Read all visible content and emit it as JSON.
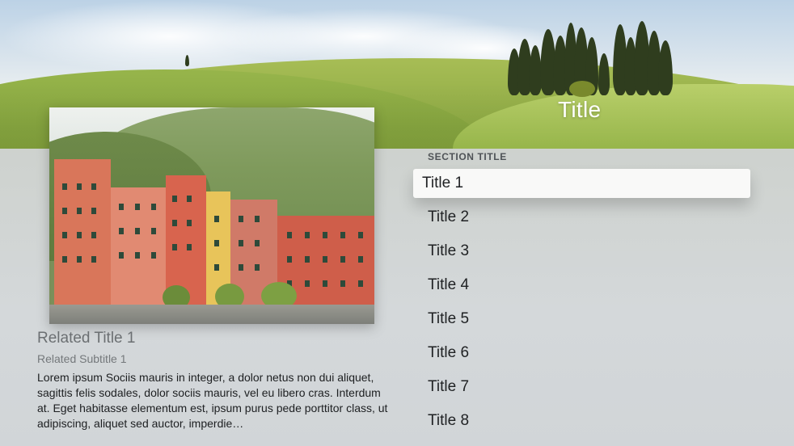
{
  "hero": {
    "title": "Title"
  },
  "related": {
    "title": "Related Title 1",
    "subtitle": "Related Subtitle 1",
    "description": "Lorem ipsum Sociis mauris in integer, a dolor netus non dui aliquet, sagittis felis sodales, dolor sociis mauris, vel eu libero cras. Interdum at. Eget habitasse elementum est, ipsum purus pede porttitor class, ut adipiscing, aliquet sed auctor, imperdie…"
  },
  "list": {
    "section_title": "SECTION TITLE",
    "items": [
      {
        "label": "Title 1",
        "focused": true
      },
      {
        "label": "Title 2",
        "focused": false
      },
      {
        "label": "Title 3",
        "focused": false
      },
      {
        "label": "Title 4",
        "focused": false
      },
      {
        "label": "Title 5",
        "focused": false
      },
      {
        "label": "Title 6",
        "focused": false
      },
      {
        "label": "Title 7",
        "focused": false
      },
      {
        "label": "Title 8",
        "focused": false
      }
    ]
  },
  "colors": {
    "focus_background": "#f9f9f8",
    "text_primary": "#1f2123",
    "text_secondary": "#6b6f72",
    "hero_title": "#ffffff"
  }
}
